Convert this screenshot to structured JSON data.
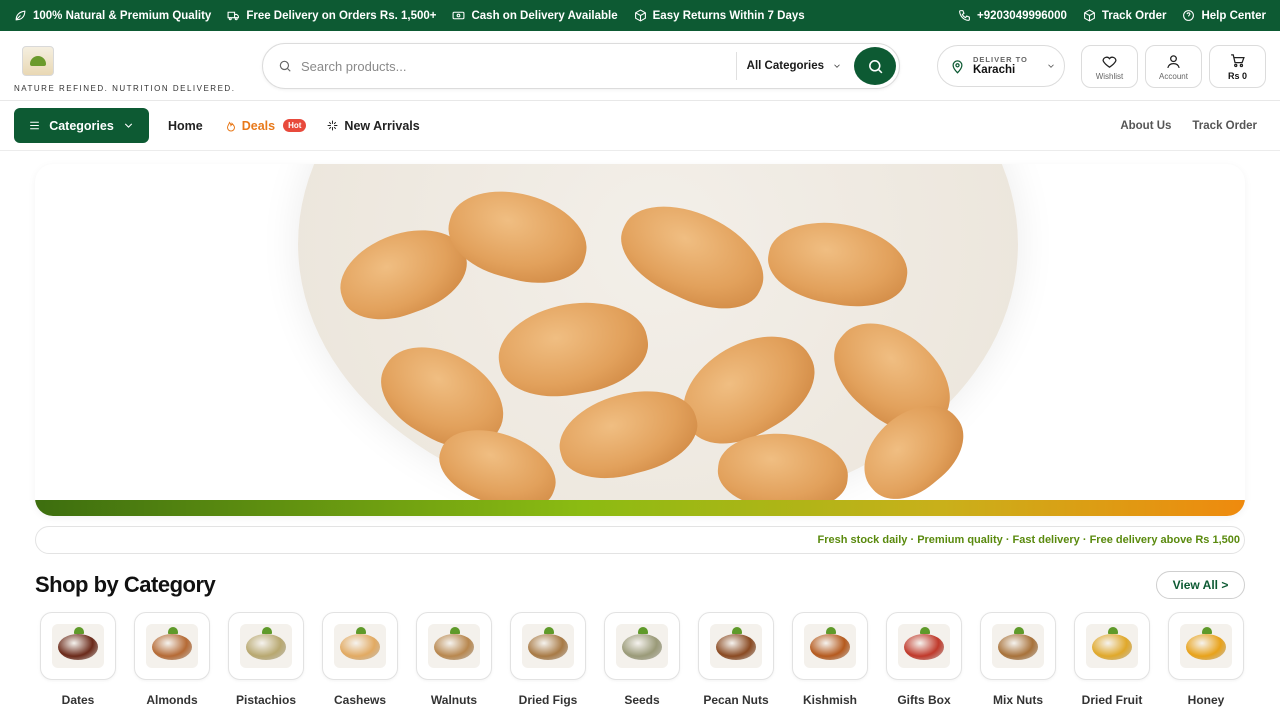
{
  "topbar": {
    "quality": "100% Natural & Premium Quality",
    "delivery": "Free Delivery on Orders Rs. 1,500+",
    "cod": "Cash on Delivery Available",
    "returns": "Easy Returns Within 7 Days",
    "phone": "+9203049996000",
    "track": "Track Order",
    "help": "Help Center"
  },
  "header": {
    "tagline": "NATURE REFINED. NUTRITION DELIVERED.",
    "search_placeholder": "Search products...",
    "category_select": "All Categories",
    "deliver_label": "DELIVER TO",
    "deliver_city": "Karachi",
    "wishlist": "Wishlist",
    "account": "Account",
    "cart": "Rs 0"
  },
  "nav": {
    "categories": "Categories",
    "home": "Home",
    "deals": "Deals",
    "hot_badge": "Hot",
    "new_arrivals": "New Arrivals",
    "about": "About Us",
    "track": "Track Order"
  },
  "ticker": "Fresh stock daily · Premium quality · Fast delivery · Free delivery above Rs 1,500",
  "shop": {
    "title": "Shop by Category",
    "view_all": "View All >",
    "categories": [
      {
        "name": "Dates",
        "color": "#6b2a1a"
      },
      {
        "name": "Almonds",
        "color": "#b56a35"
      },
      {
        "name": "Pistachios",
        "color": "#b8a870"
      },
      {
        "name": "Cashews",
        "color": "#e2aa62"
      },
      {
        "name": "Walnuts",
        "color": "#b8874e"
      },
      {
        "name": "Dried Figs",
        "color": "#a87a45"
      },
      {
        "name": "Seeds",
        "color": "#9a9a78"
      },
      {
        "name": "Pecan Nuts",
        "color": "#8a4a22"
      },
      {
        "name": "Kishmish",
        "color": "#b55a1e"
      },
      {
        "name": "Gifts Box",
        "color": "#c0392b"
      },
      {
        "name": "Mix Nuts",
        "color": "#a8723a"
      },
      {
        "name": "Dried Fruit",
        "color": "#e0a82a"
      },
      {
        "name": "Honey",
        "color": "#e8a21a"
      }
    ]
  },
  "colors": {
    "brand_green": "#0d5a33",
    "deals_orange": "#e8791a",
    "ticker_green": "#5a8a0e"
  }
}
